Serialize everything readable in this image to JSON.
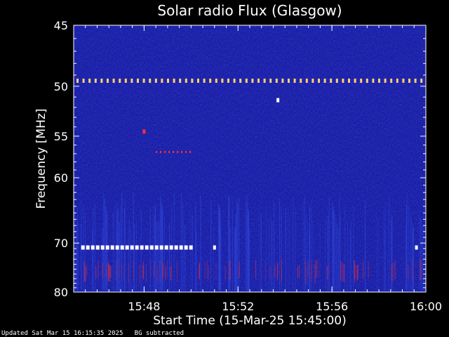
{
  "chart_data": {
    "type": "heatmap",
    "title": "Solar radio Flux (Glasgow)",
    "xlabel": "Start Time (15-Mar-25 15:45:00)",
    "ylabel": "Frequency [MHz]",
    "x_start": "15:45:00",
    "x_end": "16:00:00",
    "xlim_minutes": [
      0,
      15
    ],
    "x_ticks": [
      "15:48",
      "15:52",
      "15:56",
      "16:00"
    ],
    "x_tick_minutes": [
      3,
      7,
      11,
      15
    ],
    "ylim": [
      45,
      80
    ],
    "y_ticks": [
      45,
      50,
      55,
      60,
      70,
      80
    ],
    "y_scale": "reciprocal",
    "background_color": "#1a1ea8",
    "features": [
      {
        "kind": "horizontal_dotted_line",
        "frequency_mhz": 49.5,
        "color": "#ffd070"
      },
      {
        "kind": "horizontal_dotted_line",
        "frequency_mhz": 70.8,
        "color": "#ffffff",
        "from_minute": 0.2,
        "to_minute": 5.0
      },
      {
        "kind": "point",
        "minute": 8.7,
        "frequency_mhz": 51.3,
        "color": "#ffffff"
      },
      {
        "kind": "point",
        "minute": 6.0,
        "frequency_mhz": 70.8,
        "color": "#ffffff"
      },
      {
        "kind": "point",
        "minute": 14.6,
        "frequency_mhz": 70.8,
        "color": "#ffffff"
      },
      {
        "kind": "point",
        "minute": 3.0,
        "frequency_mhz": 54.5,
        "color": "#ff3030"
      },
      {
        "kind": "short_dotted_line",
        "frequency_mhz": 56.8,
        "from_minute": 3.5,
        "to_minute": 5.1,
        "color": "#ff3030"
      },
      {
        "kind": "vertical_streak_band",
        "from_mhz": 73,
        "to_mhz": 78,
        "color": "#b03060"
      }
    ]
  },
  "footer": {
    "updated": "Updated Sat Mar 15 16:15:35 2025",
    "note": "BG subtracted"
  }
}
